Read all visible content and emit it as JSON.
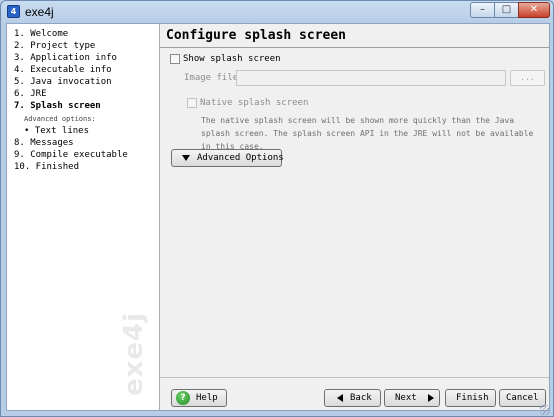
{
  "window": {
    "title": "exe4j",
    "app_icon": "exe4j-app-icon",
    "controls": {
      "minimize": "–",
      "maximize": "□",
      "close": "✕"
    }
  },
  "sidebar": {
    "watermark": "exe4j",
    "steps": [
      {
        "label": "1. Welcome",
        "active": false
      },
      {
        "label": "2. Project type",
        "active": false
      },
      {
        "label": "3. Application info",
        "active": false
      },
      {
        "label": "4. Executable info",
        "active": false
      },
      {
        "label": "5. Java invocation",
        "active": false
      },
      {
        "label": "6. JRE",
        "active": false
      },
      {
        "label": "7. Splash screen",
        "active": true
      }
    ],
    "advanced_header": "Advanced options:",
    "advanced_items": [
      "• Text lines"
    ],
    "steps_after": [
      {
        "label": "8. Messages"
      },
      {
        "label": "9. Compile executable"
      },
      {
        "label": "10. Finished"
      }
    ]
  },
  "main": {
    "title": "Configure splash screen",
    "show_splash_label": "Show splash screen",
    "show_splash_checked": false,
    "image_file_label": "Image file:",
    "image_file_value": "",
    "browse_label": "...",
    "native_splash_label": "Native splash screen",
    "native_splash_checked": false,
    "description": "The native splash screen will be shown more quickly than the Java splash screen. The splash screen API in the JRE will not be available in this case.",
    "advanced_button": "Advanced Options"
  },
  "footer": {
    "help": "Help",
    "back": "Back",
    "next": "Next",
    "finish": "Finish",
    "cancel": "Cancel"
  }
}
